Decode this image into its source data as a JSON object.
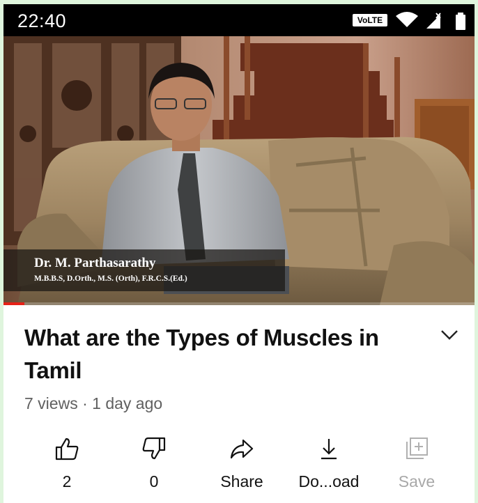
{
  "status_bar": {
    "time": "22:40",
    "network_badge": "VoLTE",
    "icons": [
      "wifi-icon",
      "cell-signal-icon",
      "battery-icon"
    ]
  },
  "video": {
    "lower_third": {
      "name": "Dr. M. Parthasarathy",
      "qualifications": "M.B.B.S, D.Orth., M.S. (Orth), F.R.C.S.(Ed.)"
    },
    "progress": 0.045,
    "progress_color": "#e62117"
  },
  "details": {
    "title": "What are the Types of Muscles in Tamil",
    "meta": "7 views · 1 day ago",
    "expand_icon": "chevron-down-icon"
  },
  "actions": [
    {
      "key": "like",
      "label": "2",
      "icon": "thumbs-up-icon",
      "enabled": true
    },
    {
      "key": "dislike",
      "label": "0",
      "icon": "thumbs-down-icon",
      "enabled": true
    },
    {
      "key": "share",
      "label": "Share",
      "icon": "share-icon",
      "enabled": true
    },
    {
      "key": "download",
      "label": "Do...oad",
      "icon": "download-icon",
      "enabled": true
    },
    {
      "key": "save",
      "label": "Save",
      "icon": "save-playlist-icon",
      "enabled": false
    }
  ]
}
